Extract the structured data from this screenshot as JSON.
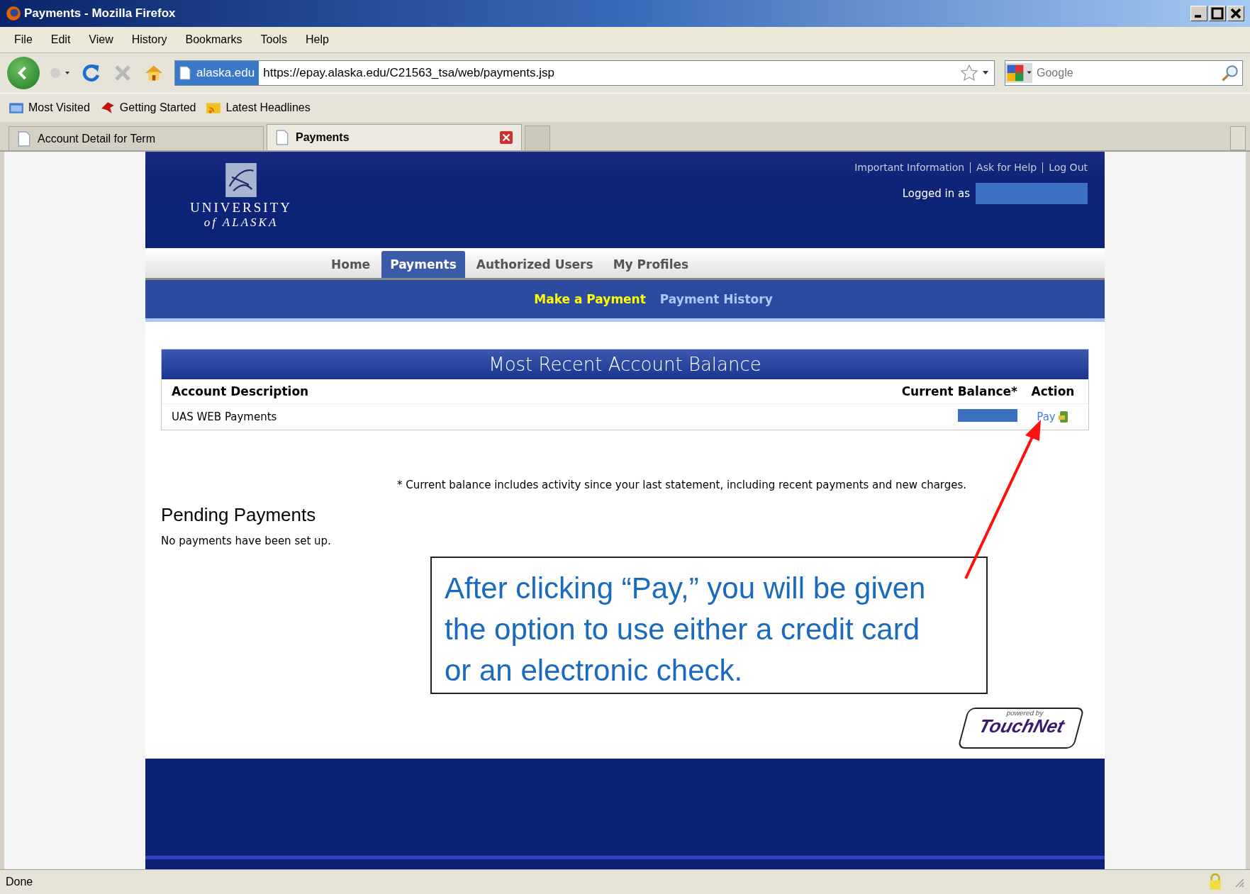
{
  "window": {
    "title": "Payments - Mozilla Firefox"
  },
  "menu": [
    "File",
    "Edit",
    "View",
    "History",
    "Bookmarks",
    "Tools",
    "Help"
  ],
  "toolbar": {
    "site_badge": "alaska.edu",
    "url": "https://epay.alaska.edu/C21563_tsa/web/payments.jsp",
    "search": {
      "placeholder": "Google"
    }
  },
  "bookmarks": [
    {
      "label": "Most Visited",
      "kind": "folder"
    },
    {
      "label": "Getting Started",
      "kind": "bird"
    },
    {
      "label": "Latest Headlines",
      "kind": "feed"
    }
  ],
  "tabs": [
    {
      "label": "Account Detail for Term",
      "selected": false
    },
    {
      "label": "Payments",
      "selected": true
    }
  ],
  "page": {
    "header_links": [
      "Important Information",
      "Ask for Help",
      "Log Out"
    ],
    "logged_in_label": "Logged in as",
    "logo": {
      "line_1": "UNIVERSITY",
      "line_2": "of ALASKA"
    },
    "nav": [
      {
        "label": "Home",
        "selected": false
      },
      {
        "label": "Payments",
        "selected": true
      },
      {
        "label": "Authorized Users",
        "selected": false
      },
      {
        "label": "My Profiles",
        "selected": false
      }
    ],
    "subnav": [
      {
        "label": "Make a Payment",
        "selected": true
      },
      {
        "label": "Payment History",
        "selected": false
      }
    ],
    "balance_table": {
      "title": "Most Recent Account Balance",
      "columns": [
        "Account Description",
        "Current Balance*",
        "Action"
      ],
      "rows": [
        {
          "description": "UAS WEB Payments",
          "action": "Pay"
        }
      ]
    },
    "footnote": "* Current balance includes activity since your last statement, including recent payments and new charges.",
    "pending": {
      "heading": "Pending Payments",
      "message": "No payments have been set up."
    },
    "powered_by": {
      "caption": "powered by",
      "name": "TouchNet"
    }
  },
  "callout": "After clicking “Pay,” you will be given the option to use either a credit card or an electronic check.",
  "status_bar": {
    "text": "Done"
  }
}
